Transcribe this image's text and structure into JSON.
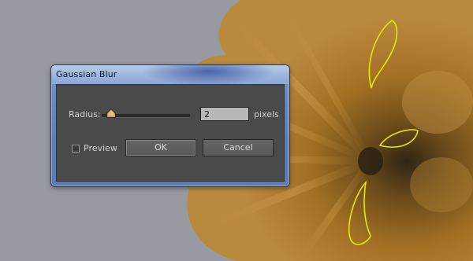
{
  "dialog": {
    "title": "Gaussian Blur",
    "radius_label": "Radius:",
    "radius_value": "2",
    "units": "pixels",
    "slider_level": 0.05,
    "preview_label": "Preview",
    "preview_checked": false,
    "ok_label": "OK",
    "cancel_label": "Cancel"
  },
  "colors": {
    "canvas_background": "#989aa1",
    "petal_color": "#b07a25",
    "selection_outline": "#e6e600",
    "dialog_client": "#4a4a4a",
    "title_bar": "#9fb7de"
  }
}
